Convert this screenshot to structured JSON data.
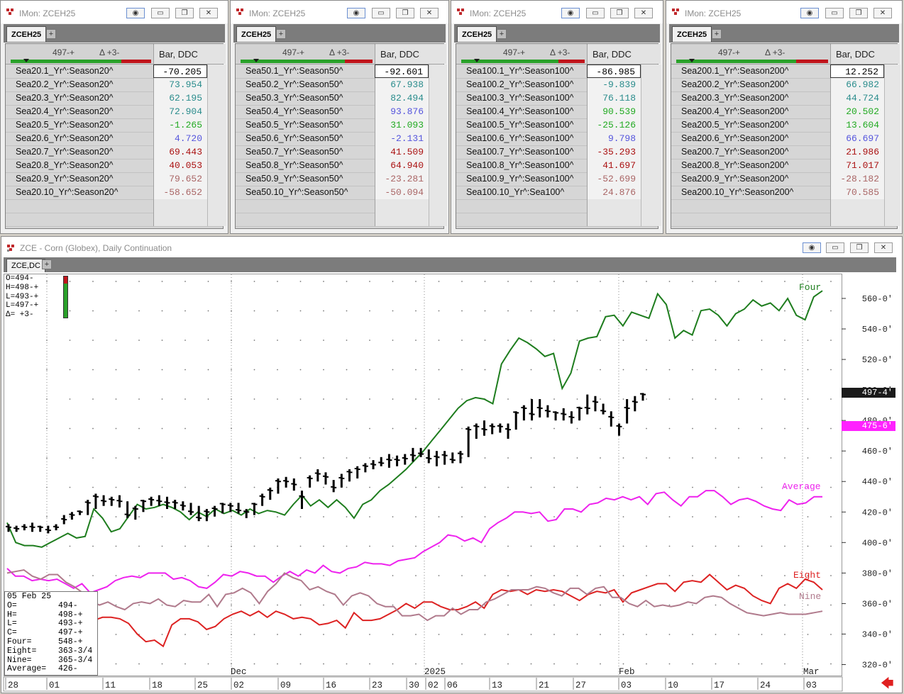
{
  "monitors": [
    {
      "title": "IMon: ZCEH25",
      "tab": "ZCEH25",
      "quote_last": "497-+",
      "quote_delta": "Δ +3-",
      "col_header": "Bar, DDC",
      "rows": [
        {
          "name": "Sea20.1_Yr^:Season20^",
          "value": "-70.205",
          "color": "#000000"
        },
        {
          "name": "Sea20.2_Yr^:Season20^",
          "value": "73.954",
          "color": "#2a8c8c"
        },
        {
          "name": "Sea20.3_Yr^:Season20^",
          "value": "62.195",
          "color": "#2a8c8c"
        },
        {
          "name": "Sea20.4_Yr^:Season20^",
          "value": "72.904",
          "color": "#2a8c8c"
        },
        {
          "name": "Sea20.5_Yr^:Season20^",
          "value": "-1.265",
          "color": "#22aa22"
        },
        {
          "name": "Sea20.6_Yr^:Season20^",
          "value": "4.720",
          "color": "#5555dd"
        },
        {
          "name": "Sea20.7_Yr^:Season20^",
          "value": "69.443",
          "color": "#aa1111"
        },
        {
          "name": "Sea20.8_Yr^:Season20^",
          "value": "40.053",
          "color": "#aa1111"
        },
        {
          "name": "Sea20.9_Yr^:Season20^",
          "value": "79.652",
          "color": "#aa6666"
        },
        {
          "name": "Sea20.10_Yr^:Season20^",
          "value": "-58.652",
          "color": "#aa6666"
        }
      ]
    },
    {
      "title": "IMon: ZCEH25",
      "tab": "ZCEH25",
      "quote_last": "497-+",
      "quote_delta": "Δ +3-",
      "col_header": "Bar, DDC",
      "rows": [
        {
          "name": "Sea50.1_Yr^:Season50^",
          "value": "-92.601",
          "color": "#000000"
        },
        {
          "name": "Sea50.2_Yr^:Season50^",
          "value": "67.938",
          "color": "#2a8c8c"
        },
        {
          "name": "Sea50.3_Yr^:Season50^",
          "value": "82.494",
          "color": "#2a8c8c"
        },
        {
          "name": "Sea50.4_Yr^:Season50^",
          "value": "93.876",
          "color": "#5555dd"
        },
        {
          "name": "Sea50.5_Yr^:Season50^",
          "value": "31.093",
          "color": "#22aa22"
        },
        {
          "name": "Sea50.6_Yr^:Season50^",
          "value": "-2.131",
          "color": "#5555dd"
        },
        {
          "name": "Sea50.7_Yr^:Season50^",
          "value": "41.509",
          "color": "#aa1111"
        },
        {
          "name": "Sea50.8_Yr^:Season50^",
          "value": "64.940",
          "color": "#aa1111"
        },
        {
          "name": "Sea50.9_Yr^:Season50^",
          "value": "-23.281",
          "color": "#aa6666"
        },
        {
          "name": "Sea50.10_Yr^:Season50^",
          "value": "-50.094",
          "color": "#aa6666"
        }
      ]
    },
    {
      "title": "IMon: ZCEH25",
      "tab": "ZCEH25",
      "quote_last": "497-+",
      "quote_delta": "Δ +3-",
      "col_header": "Bar, DDC",
      "rows": [
        {
          "name": "Sea100.1_Yr^:Season100^",
          "value": "-86.985",
          "color": "#000000"
        },
        {
          "name": "Sea100.2_Yr^:Season100^",
          "value": "-9.839",
          "color": "#2a8c8c"
        },
        {
          "name": "Sea100.3_Yr^:Season100^",
          "value": "76.118",
          "color": "#2a8c8c"
        },
        {
          "name": "Sea100.4_Yr^:Season100^",
          "value": "90.539",
          "color": "#22aa22"
        },
        {
          "name": "Sea100.5_Yr^:Season100^",
          "value": "-25.126",
          "color": "#22aa22"
        },
        {
          "name": "Sea100.6_Yr^:Season100^",
          "value": "9.798",
          "color": "#5555dd"
        },
        {
          "name": "Sea100.7_Yr^:Season100^",
          "value": "-35.293",
          "color": "#aa1111"
        },
        {
          "name": "Sea100.8_Yr^:Season100^",
          "value": "41.697",
          "color": "#aa1111"
        },
        {
          "name": "Sea100.9_Yr^:Season100^",
          "value": "-52.699",
          "color": "#aa6666"
        },
        {
          "name": "Sea100.10_Yr^:Sea100^",
          "value": "24.876",
          "color": "#aa6666"
        }
      ]
    },
    {
      "title": "IMon: ZCEH25",
      "tab": "ZCEH25",
      "quote_last": "497-+",
      "quote_delta": "Δ +3-",
      "col_header": "Bar, DDC",
      "rows": [
        {
          "name": "Sea200.1_Yr^:Season200^",
          "value": "12.252",
          "color": "#000000"
        },
        {
          "name": "Sea200.2_Yr^:Season200^",
          "value": "66.982",
          "color": "#2a8c8c"
        },
        {
          "name": "Sea200.3_Yr^:Season200^",
          "value": "44.724",
          "color": "#2a8c8c"
        },
        {
          "name": "Sea200.4_Yr^:Season200^",
          "value": "20.502",
          "color": "#22aa22"
        },
        {
          "name": "Sea200.5_Yr^:Season200^",
          "value": "13.604",
          "color": "#22aa22"
        },
        {
          "name": "Sea200.6_Yr^:Season200^",
          "value": "66.697",
          "color": "#5555dd"
        },
        {
          "name": "Sea200.7_Yr^:Season200^",
          "value": "21.986",
          "color": "#aa1111"
        },
        {
          "name": "Sea200.8_Yr^:Season200^",
          "value": "71.017",
          "color": "#aa1111"
        },
        {
          "name": "Sea200.9_Yr^:Season200^",
          "value": "-28.182",
          "color": "#aa6666"
        },
        {
          "name": "Sea200.10_Yr^:Season200^",
          "value": "70.585",
          "color": "#aa6666"
        }
      ]
    }
  ],
  "chart_window": {
    "title": "ZCE - Corn (Globex), Daily Continuation",
    "tab": "ZCE,DC",
    "ohlc_panel": [
      "O=494-",
      "H=498-+",
      "L=493-+",
      "L=497-+",
      "Δ= +3-"
    ],
    "cursor_panel": {
      "date": "05 Feb 25",
      "rows": [
        [
          "O=",
          "494-"
        ],
        [
          "H=",
          "498-+"
        ],
        [
          "L=",
          "493-+"
        ],
        [
          "C=",
          "497-+"
        ],
        [
          "Four=",
          "548-+"
        ],
        [
          "Eight=",
          "363-3/4"
        ],
        [
          "Nine=",
          "365-3/4"
        ],
        [
          "Average=",
          "426-"
        ]
      ]
    },
    "price_tag_last": "497-4'",
    "price_tag_avg": "475-6'"
  },
  "chart_data": {
    "type": "line",
    "y_ticks": [
      "320-0'",
      "340-0'",
      "360-0'",
      "380-0'",
      "400-0'",
      "420-0'",
      "440-0'",
      "460-0'",
      "480-0'",
      "500-0'",
      "520-0'",
      "540-0'",
      "560-0'"
    ],
    "ylim": [
      310,
      573
    ],
    "x_tick_labels": [
      "28",
      "01",
      "11",
      "18",
      "25",
      "02",
      "09",
      "16",
      "23",
      "30",
      "02",
      "06",
      "13",
      "21",
      "27",
      "03",
      "10",
      "17",
      "24",
      "03"
    ],
    "x_month_labels": [
      "Dec",
      "2025",
      "Feb",
      "Mar"
    ],
    "series": [
      {
        "name": "Four",
        "color": "#1e7d1e",
        "values": [
          413,
          400,
          398,
          398,
          397,
          400,
          403,
          406,
          403,
          404,
          422,
          416,
          407,
          409,
          417,
          425,
          422,
          423,
          425,
          423,
          420,
          415,
          420,
          417,
          422,
          419,
          421,
          418,
          422,
          419,
          421,
          420,
          418,
          425,
          431,
          424,
          428,
          423,
          428,
          423,
          416,
          425,
          428,
          434,
          438,
          443,
          448,
          454,
          460,
          467,
          474,
          481,
          488,
          493,
          495,
          494,
          491,
          517,
          526,
          534,
          531,
          527,
          522,
          524,
          501,
          511,
          532,
          534,
          535,
          548,
          549,
          542,
          551,
          549,
          547,
          563,
          556,
          534,
          539,
          536,
          552,
          553,
          549,
          542,
          550,
          553,
          559,
          555,
          557,
          552,
          560,
          549,
          546,
          561,
          565
        ]
      },
      {
        "name": "Average",
        "color": "#ee22ee",
        "values": [
          383,
          378,
          378,
          375,
          376,
          375,
          376,
          373,
          370,
          373,
          367,
          369,
          371,
          375,
          377,
          378,
          377,
          380,
          380,
          380,
          376,
          377,
          375,
          371,
          370,
          374,
          379,
          378,
          381,
          380,
          378,
          378,
          374,
          378,
          381,
          378,
          382,
          380,
          385,
          381,
          380,
          383,
          384,
          387,
          386,
          386,
          385,
          388,
          389,
          390,
          394,
          397,
          400,
          405,
          404,
          401,
          403,
          400,
          409,
          413,
          416,
          420,
          420,
          419,
          420,
          414,
          415,
          422,
          422,
          420,
          425,
          426,
          429,
          428,
          430,
          428,
          430,
          425,
          432,
          433,
          428,
          424,
          430,
          430,
          434,
          434,
          430,
          425,
          428,
          429,
          427,
          424,
          422,
          421,
          428,
          425,
          426,
          430,
          430
        ]
      },
      {
        "name": "Eight",
        "color": "#dd2222",
        "values": [
          350,
          345,
          342,
          338,
          341,
          337,
          341,
          338,
          341,
          344,
          349,
          351,
          351,
          350,
          347,
          340,
          335,
          336,
          332,
          346,
          350,
          350,
          348,
          343,
          345,
          350,
          353,
          355,
          352,
          355,
          351,
          355,
          353,
          350,
          351,
          350,
          346,
          347,
          349,
          344,
          354,
          349,
          349,
          350,
          353,
          356,
          360,
          357,
          361,
          361,
          358,
          356,
          356,
          358,
          361,
          357,
          366,
          369,
          368,
          369,
          366,
          369,
          368,
          369,
          368,
          365,
          362,
          366,
          368,
          367,
          369,
          361,
          367,
          369,
          371,
          373,
          373,
          368,
          374,
          375,
          374,
          379,
          374,
          369,
          372,
          370,
          365,
          362,
          360,
          370,
          373,
          370,
          376,
          374,
          369
        ]
      },
      {
        "name": "Nine",
        "color": "#b07a8c",
        "values": [
          380,
          381,
          382,
          378,
          376,
          379,
          379,
          374,
          371,
          367,
          361,
          359,
          361,
          358,
          356,
          360,
          361,
          360,
          363,
          359,
          358,
          362,
          361,
          361,
          366,
          358,
          366,
          367,
          370,
          367,
          360,
          368,
          373,
          380,
          377,
          375,
          369,
          371,
          368,
          366,
          359,
          365,
          367,
          365,
          360,
          358,
          358,
          352,
          352,
          353,
          349,
          352,
          352,
          357,
          353,
          356,
          356,
          361,
          363,
          366,
          369,
          369,
          369,
          371,
          370,
          367,
          365,
          370,
          370,
          366,
          370,
          371,
          364,
          364,
          360,
          358,
          362,
          358,
          359,
          358,
          359,
          361,
          360,
          364,
          365,
          364,
          360,
          357,
          354,
          353,
          352,
          353,
          354,
          353,
          353,
          353,
          354,
          355
        ]
      }
    ],
    "ohlc": [
      [
        412,
        407,
        410
      ],
      [
        411,
        407,
        409
      ],
      [
        412,
        408,
        410
      ],
      [
        413,
        407,
        410
      ],
      [
        411,
        407,
        410
      ],
      [
        411,
        406,
        408
      ],
      [
        412,
        408,
        410
      ],
      [
        418,
        412,
        415
      ],
      [
        420,
        415,
        418
      ],
      [
        421,
        418,
        420
      ],
      [
        428,
        418,
        426
      ],
      [
        432,
        422,
        430
      ],
      [
        431,
        424,
        427
      ],
      [
        430,
        424,
        428
      ],
      [
        431,
        423,
        427
      ],
      [
        427,
        416,
        418
      ],
      [
        424,
        415,
        422
      ],
      [
        428,
        420,
        427
      ],
      [
        430,
        424,
        428
      ],
      [
        431,
        424,
        427
      ],
      [
        430,
        422,
        426
      ],
      [
        428,
        422,
        426
      ],
      [
        427,
        421,
        424
      ],
      [
        426,
        418,
        420
      ],
      [
        424,
        414,
        416
      ],
      [
        422,
        414,
        420
      ],
      [
        424,
        417,
        422
      ],
      [
        426,
        419,
        425
      ],
      [
        426,
        420,
        424
      ],
      [
        426,
        419,
        421
      ],
      [
        422,
        416,
        420
      ],
      [
        426,
        418,
        425
      ],
      [
        432,
        424,
        430
      ],
      [
        436,
        428,
        434
      ],
      [
        442,
        432,
        440
      ],
      [
        443,
        436,
        440
      ],
      [
        442,
        434,
        438
      ],
      [
        434,
        422,
        430
      ],
      [
        444,
        436,
        442
      ],
      [
        448,
        440,
        445
      ],
      [
        446,
        438,
        443
      ],
      [
        441,
        433,
        436
      ],
      [
        445,
        436,
        442
      ],
      [
        448,
        440,
        446
      ],
      [
        450,
        442,
        448
      ],
      [
        452,
        446,
        450
      ],
      [
        454,
        448,
        451
      ],
      [
        456,
        450,
        452
      ],
      [
        458,
        449,
        454
      ],
      [
        457,
        450,
        454
      ],
      [
        458,
        451,
        455
      ],
      [
        462,
        453,
        457
      ],
      [
        462,
        456,
        458
      ],
      [
        461,
        452,
        455
      ],
      [
        460,
        450,
        456
      ],
      [
        460,
        451,
        457
      ],
      [
        459,
        452,
        454
      ],
      [
        460,
        452,
        458
      ],
      [
        476,
        456,
        474
      ],
      [
        478,
        468,
        476
      ],
      [
        480,
        470,
        474
      ],
      [
        478,
        471,
        476
      ],
      [
        478,
        472,
        476
      ],
      [
        478,
        468,
        474
      ],
      [
        486,
        474,
        485
      ],
      [
        490,
        480,
        488
      ],
      [
        494,
        480,
        484
      ],
      [
        494,
        482,
        488
      ],
      [
        490,
        482,
        486
      ],
      [
        486,
        480,
        485
      ],
      [
        488,
        480,
        484
      ],
      [
        486,
        478,
        482
      ],
      [
        489,
        480,
        488
      ],
      [
        497,
        484,
        488
      ],
      [
        496,
        486,
        492
      ],
      [
        491,
        484,
        486
      ],
      [
        486,
        476,
        482
      ],
      [
        478,
        470,
        476
      ],
      [
        494,
        478,
        488
      ],
      [
        496,
        486,
        492
      ],
      [
        498,
        493,
        497
      ]
    ]
  }
}
